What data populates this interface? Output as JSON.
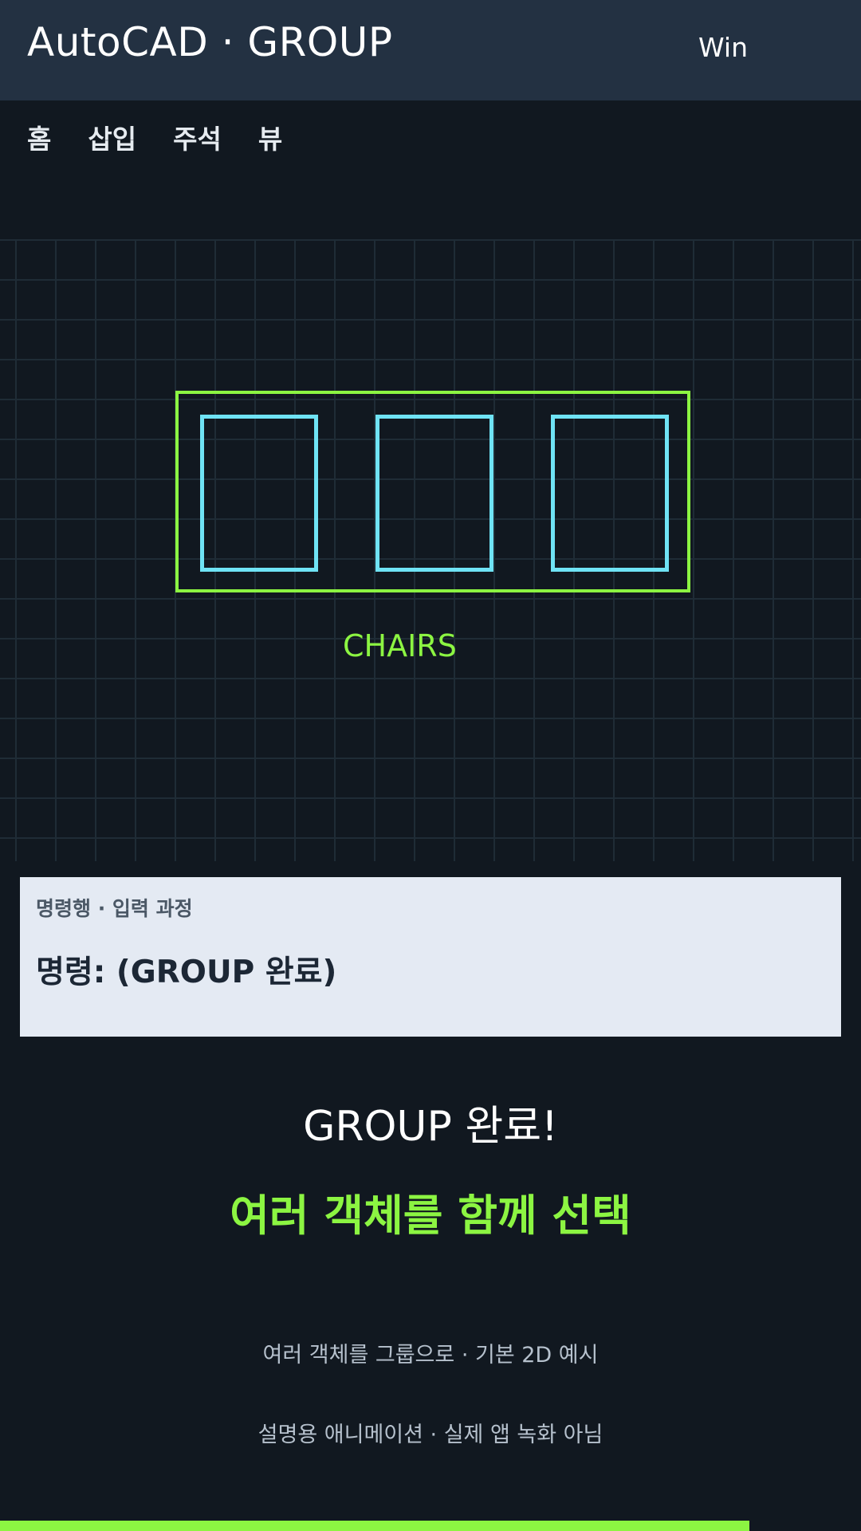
{
  "titlebar": {
    "title": "AutoCAD · GROUP",
    "platform": "Win"
  },
  "ribbon": {
    "tabs": [
      "홈",
      "삽입",
      "주석",
      "뷰"
    ]
  },
  "viewport": {
    "group_label": "CHAIRS"
  },
  "command": {
    "caption": "명령행 · 입력 과정",
    "text": "명령: (GROUP 완료)"
  },
  "result": {
    "headline": "GROUP 완료!",
    "subhead": "여러 객체를 함께 선택"
  },
  "notes": [
    "여러 객체를 그룹으로 · 기본 2D 예시",
    "설명용 애니메이션 · 실제 앱 녹화 아님"
  ],
  "progress": {
    "fraction": 0.87
  },
  "colors": {
    "accent": "#8cf542",
    "chair": "#6fe3f5",
    "titlebar": "#233142",
    "background": "#111820"
  }
}
